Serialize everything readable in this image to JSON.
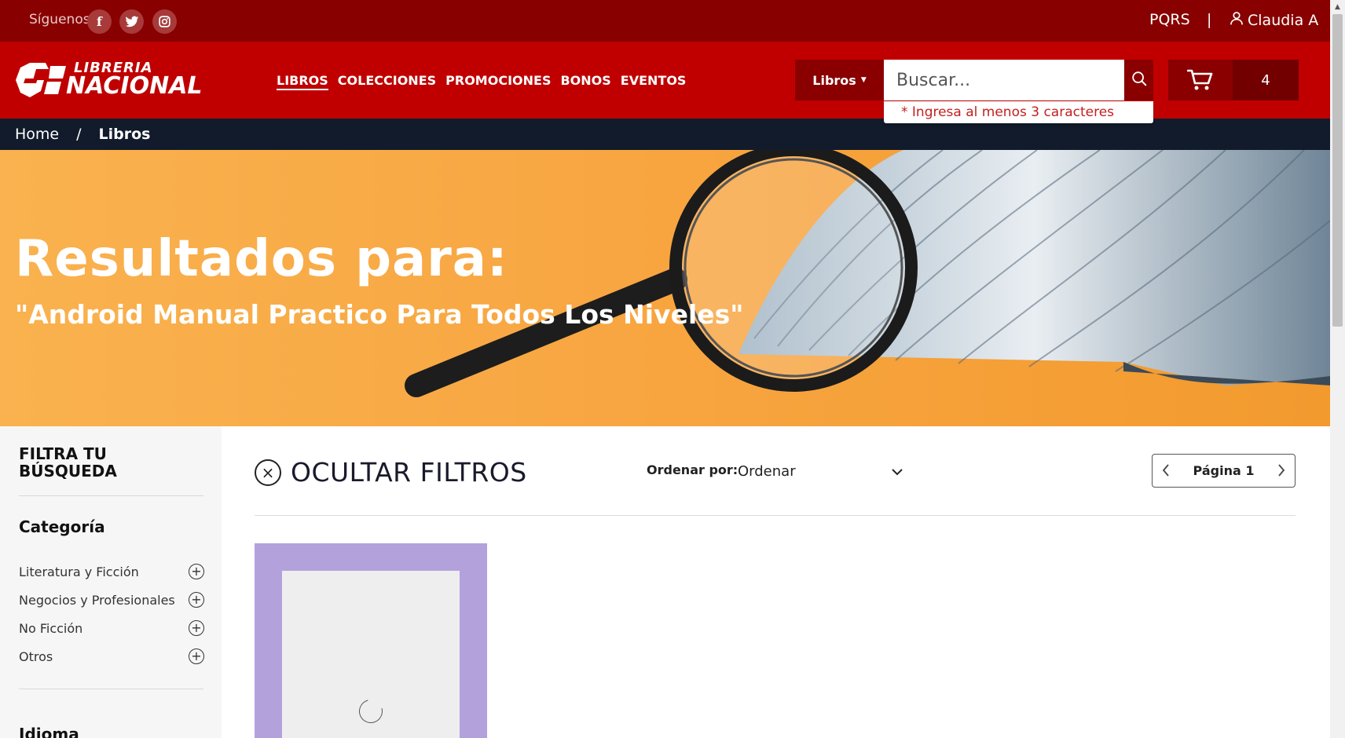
{
  "topbar": {
    "follow_label": "Síguenos",
    "social": [
      {
        "name": "facebook-icon",
        "glyph": "f"
      },
      {
        "name": "twitter-icon",
        "glyph": "t"
      },
      {
        "name": "instagram-icon",
        "glyph": "◎"
      }
    ],
    "pqrs": "PQRS",
    "separator": "|",
    "user_name": "Claudia A"
  },
  "header": {
    "logo_top": "LIBRERIA",
    "logo_bottom": "NACIONAL",
    "nav": [
      {
        "label": "LIBROS",
        "active": true
      },
      {
        "label": "COLECCIONES",
        "active": false
      },
      {
        "label": "PROMOCIONES",
        "active": false
      },
      {
        "label": "BONOS",
        "active": false
      },
      {
        "label": "EVENTOS",
        "active": false
      }
    ],
    "search_category": "Libros",
    "search_placeholder": "Buscar...",
    "search_hint": "* Ingresa al menos 3 caracteres",
    "cart_count": "4"
  },
  "breadcrumb": {
    "home": "Home",
    "separator": "/",
    "current": "Libros"
  },
  "banner": {
    "title": "Resultados para:",
    "query": "\"Android Manual Practico Para Todos Los Niveles\""
  },
  "sidebar": {
    "title": "FILTRA TU BÚSQUEDA",
    "category_heading": "Categoría",
    "categories": [
      "Literatura y Ficción",
      "Negocios y Profesionales",
      "No Ficción",
      "Otros"
    ],
    "language_heading": "Idioma"
  },
  "main": {
    "hide_filters": "OCULTAR FILTROS",
    "sort_label": "Ordenar por:",
    "sort_value": "Ordenar",
    "page_label": "Página 1"
  },
  "colors": {
    "topbar": "#880000",
    "header": "#c00000",
    "breadcrumb": "#111b2b",
    "banner": "#f8a540",
    "card": "#b3a1dc"
  }
}
